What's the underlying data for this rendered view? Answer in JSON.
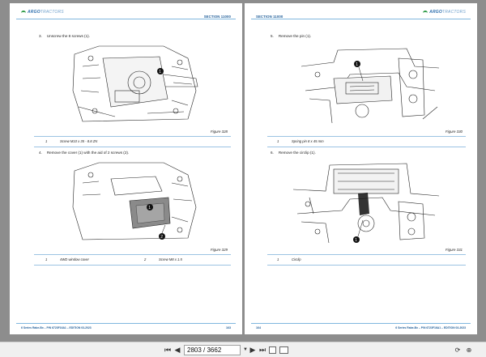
{
  "pages": [
    {
      "section": "SECTION 11000",
      "brand": {
        "name": "ARGO",
        "suffix": "TRACTORS"
      },
      "steps": [
        {
          "number": "3.",
          "text": "Unscrew the 8 screws (1)."
        },
        {
          "number": "4.",
          "text": "Remove the cover (1) with the aid of 2 screws (2)."
        }
      ],
      "figures": [
        {
          "label": "Figure 328",
          "legend": [
            {
              "n": "1",
              "text": "Screw M10 x 35 - 8.8 ZN"
            }
          ]
        },
        {
          "label": "Figure 329",
          "legend": [
            {
              "n": "1",
              "text": "4WD window cover"
            },
            {
              "n": "2",
              "text": "Screw M8 x 1.5"
            }
          ]
        }
      ],
      "footer": "6 Series Rabe-Bx – P/N 6723F16A1 – EDITION 03-2023",
      "page_number": "163"
    },
    {
      "section": "SECTION 11000",
      "brand": {
        "name": "ARGO",
        "suffix": "TRACTORS"
      },
      "steps": [
        {
          "number": "5.",
          "text": "Remove the pin (1)."
        },
        {
          "number": "6.",
          "text": "Remove the circlip (1)."
        }
      ],
      "figures": [
        {
          "label": "Figure 330",
          "legend": [
            {
              "n": "1",
              "text": "Spring pin 8 x 45 mm"
            }
          ]
        },
        {
          "label": "Figure 331",
          "legend": [
            {
              "n": "1",
              "text": "Circlip"
            }
          ]
        }
      ],
      "footer": "6 Series Rabe-Bx – P/N 6723F16A1 – EDITION 03-2023",
      "page_number": "164"
    }
  ],
  "toolbar": {
    "page_indicator": "2803 / 3662",
    "icons": [
      "first-page-icon",
      "prev-page-icon",
      "next-page-icon",
      "last-page-icon",
      "page-menu-icon",
      "fit-page-icon",
      "fit-width-icon",
      "rotate-icon",
      "zoom-icon"
    ]
  },
  "colors": {
    "accent": "#1f5d98",
    "rule": "#7fb6de",
    "brand_green": "#2e9a46"
  }
}
